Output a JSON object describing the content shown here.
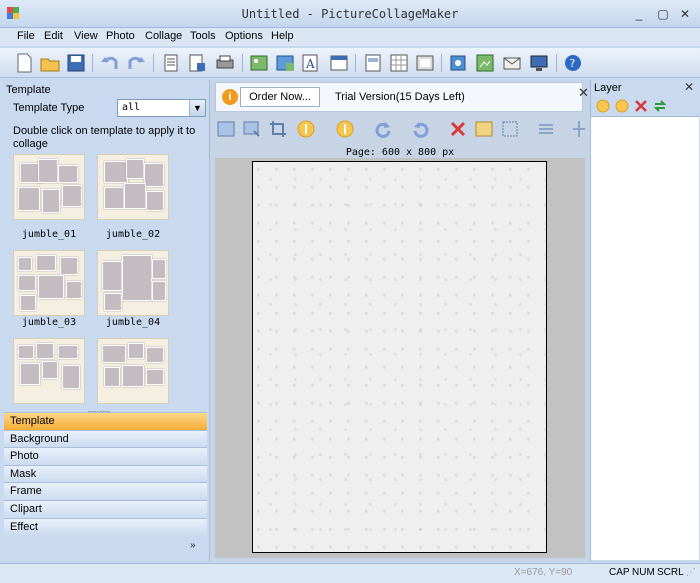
{
  "window": {
    "title": "Untitled - PictureCollageMaker"
  },
  "menu": [
    "File",
    "Edit",
    "View",
    "Photo",
    "Collage",
    "Tools",
    "Options",
    "Help"
  ],
  "template_panel": {
    "title": "Template",
    "type_label": "Template Type",
    "type_value": "all",
    "hint": "Double click on template to apply it to collage",
    "templates": [
      "jumble_01",
      "jumble_02",
      "jumble_03",
      "jumble_04"
    ]
  },
  "accordion": [
    "Template",
    "Background",
    "Photo",
    "Mask",
    "Frame",
    "Clipart",
    "Effect"
  ],
  "order_bar": {
    "button": "Order Now...",
    "trial_text": "Trial Version(15 Days Left)"
  },
  "canvas": {
    "page_label": "Page: 600 x 800 px"
  },
  "layer_panel": {
    "title": "Layer"
  },
  "status": {
    "coords": "X=676, Y=90",
    "cap": "CAP",
    "num": "NUM",
    "scrl": "SCRL"
  }
}
